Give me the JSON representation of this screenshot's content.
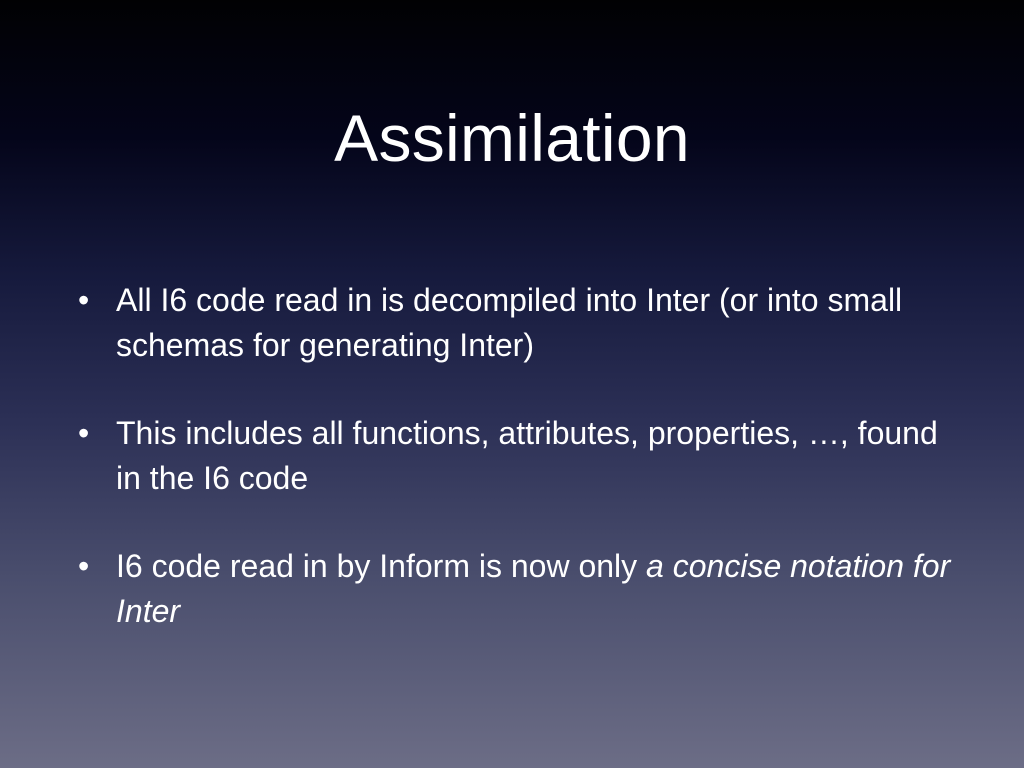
{
  "slide": {
    "title": "Assimilation",
    "bullet_glyph": "•",
    "bullets": [
      {
        "text": "All I6 code read in is decompiled into Inter (or into small schemas for generating Inter)",
        "emphasis": ""
      },
      {
        "text": "This includes all functions, attributes, properties, …, found in the I6 code",
        "emphasis": ""
      },
      {
        "text": "I6 code read in by Inform is now only ",
        "emphasis": "a concise notation for Inter"
      }
    ]
  },
  "colors": {
    "text": "#ffffff",
    "background_top": "#010103",
    "background_bottom": "#6c6d86"
  }
}
